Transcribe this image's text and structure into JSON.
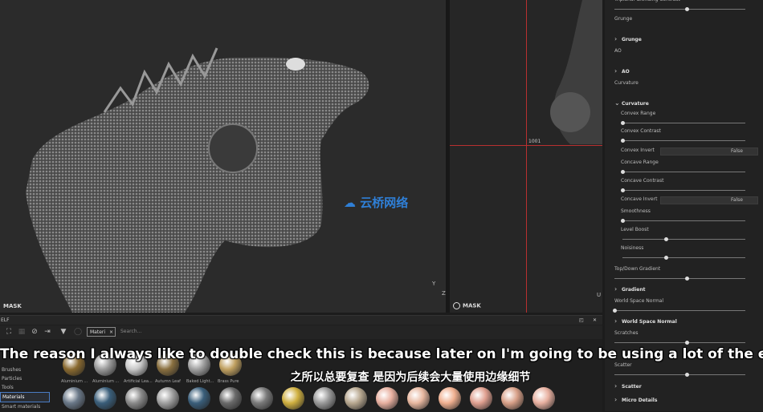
{
  "viewport3d": {
    "mask_label": "MASK",
    "axis_labels": [
      "Y",
      "Z"
    ]
  },
  "viewport2d": {
    "mask_label": "MASK",
    "udim": "1001",
    "axis_label": "U"
  },
  "watermark": {
    "text": "云桥网络"
  },
  "panel": {
    "rows": [
      {
        "label": "Triplanar Blending Contrast",
        "kind": "slider",
        "value": 0.55
      },
      {
        "label": "Grunge",
        "kind": "label"
      },
      {
        "label": "Grunge",
        "kind": "group"
      },
      {
        "label": "AO",
        "kind": "label"
      },
      {
        "label": "AO",
        "kind": "group"
      },
      {
        "label": "Curvature",
        "kind": "label"
      },
      {
        "label": "Curvature",
        "kind": "group-open"
      },
      {
        "label": "Convex Range",
        "kind": "slider",
        "value": 0.0
      },
      {
        "label": "Convex Contrast",
        "kind": "slider",
        "value": 0.0
      },
      {
        "label": "Convex Invert",
        "kind": "dropdown",
        "value": "False"
      },
      {
        "label": "Concave Range",
        "kind": "slider",
        "value": 0.0
      },
      {
        "label": "Concave Contrast",
        "kind": "slider",
        "value": 0.0
      },
      {
        "label": "Concave Invert",
        "kind": "dropdown",
        "value": "False"
      },
      {
        "label": "Smoothness",
        "kind": "slider",
        "value": 0.0
      },
      {
        "label": "Level Boost",
        "kind": "slider",
        "value": 0.35
      },
      {
        "label": "Noisiness",
        "kind": "slider",
        "value": 0.35
      },
      {
        "label": "Top/Down Gradient",
        "kind": "slider",
        "value": 0.55
      },
      {
        "label": "Gradient",
        "kind": "group"
      },
      {
        "label": "World Space Normal",
        "kind": "slider",
        "value": 0.0
      },
      {
        "label": "World Space Normal",
        "kind": "group"
      },
      {
        "label": "Scratches",
        "kind": "slider",
        "value": 0.55
      },
      {
        "label": "Scatter",
        "kind": "slider",
        "value": 0.55
      },
      {
        "label": "Scatter",
        "kind": "group"
      },
      {
        "label": "Micro Details",
        "kind": "group"
      }
    ]
  },
  "shelf": {
    "title": "ELF",
    "filter_chip": "Materi",
    "search_placeholder": "Search...",
    "categories": [
      "Brushes",
      "Particles",
      "Tools",
      "Materials",
      "Smart materials"
    ],
    "selected_category": "Materials",
    "row1_labels": [
      "Aluminium ...",
      "Aluminium ...",
      "Artificial Lea...",
      "Autumn Leaf",
      "Baked Light...",
      "Brass Pure"
    ],
    "colors": {
      "accent": "#4a7cc4",
      "uv_line": "#b83030"
    }
  },
  "subtitles": {
    "english": "The reason I always like to double check this is because later on I'm going to be using a lot of the edge",
    "chinese": "之所以总要复查 是因为后续会大量使用边缘细节"
  }
}
